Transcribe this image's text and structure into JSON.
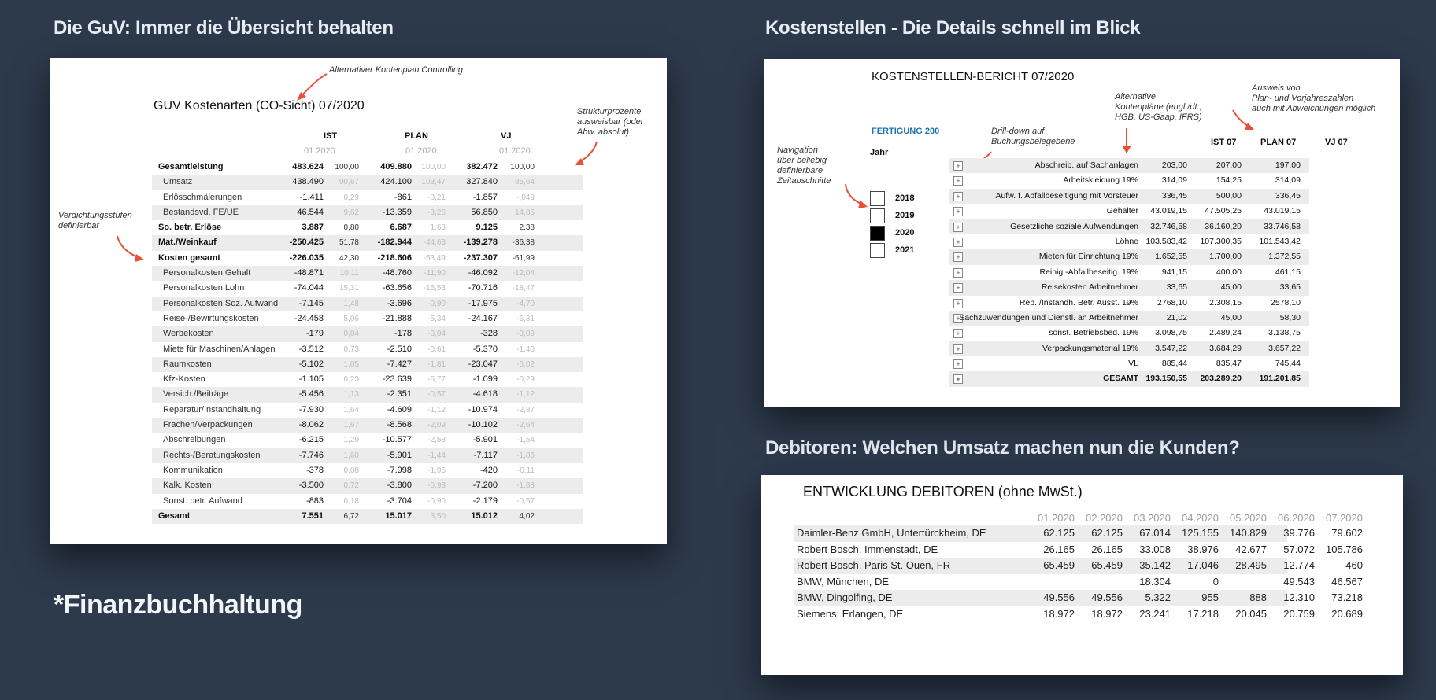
{
  "sections": {
    "guv": "Die GuV: Immer die Übersicht behalten",
    "kost": "Kostenstellen - Die Details schnell im Blick",
    "debit": "Debitoren: Welchen Umsatz machen nun die Kunden?"
  },
  "footer": "*Finanzbuchhaltung",
  "guv": {
    "title": "GUV Kostenarten (CO-Sicht) 07/2020",
    "notes": {
      "kontenplan": "Alternativer Kontenplan Controlling",
      "struktur": [
        "Strukturprozente",
        "ausweisbar (oder",
        "Abw. absolut)"
      ],
      "verdichtung": [
        "Verdichtungsstufen",
        "definierbar"
      ]
    },
    "columns": [
      "IST",
      "PLAN",
      "VJ"
    ],
    "periods": [
      "01.2020",
      "01.2020",
      "01.2020"
    ],
    "rows": [
      {
        "label": "Gesamtleistung",
        "v": [
          "483.624",
          "100,00",
          "409.880",
          "100,00",
          "382.472",
          "100,00"
        ],
        "bold": true,
        "alt": false
      },
      {
        "label": "Umsatz",
        "v": [
          "438.490",
          "90,67",
          "424.100",
          "103,47",
          "327.840",
          "85,64"
        ],
        "bold": false,
        "alt": true
      },
      {
        "label": "Erlösschmälerungen",
        "v": [
          "-1.411",
          "0,29",
          "-861",
          "-0,21",
          "-1.857",
          "-,049"
        ],
        "bold": false,
        "alt": false
      },
      {
        "label": "Bestandsvd. FE/UE",
        "v": [
          "46.544",
          "9,62",
          "-13.359",
          "-3,26",
          "56.850",
          "14,85"
        ],
        "bold": false,
        "alt": true
      },
      {
        "label": "So. betr. Erlöse",
        "v": [
          "3.887",
          "0,80",
          "6.687",
          "1,63",
          "9.125",
          "2,38"
        ],
        "bold": true,
        "alt": false
      },
      {
        "label": "Mat./Weinkauf",
        "v": [
          "-250.425",
          "51,78",
          "-182.944",
          "-44,63",
          "-139.278",
          "-36,38"
        ],
        "bold": true,
        "alt": true
      },
      {
        "label": "Kosten gesamt",
        "v": [
          "-226.035",
          "42,30",
          "-218.606",
          "-53,49",
          "-237.307",
          "-61,99"
        ],
        "bold": true,
        "alt": false
      },
      {
        "label": "Personalkosten Gehalt",
        "v": [
          "-48.871",
          "10,11",
          "-48.760",
          "-11,90",
          "-46.092",
          "-12,04"
        ],
        "bold": false,
        "alt": true
      },
      {
        "label": "Personalkosten Lohn",
        "v": [
          "-74.044",
          "15,31",
          "-63.656",
          "-15,53",
          "-70.716",
          "-18,47"
        ],
        "bold": false,
        "alt": false
      },
      {
        "label": "Personalkosten Soz. Aufwand",
        "v": [
          "-7.145",
          "1,48",
          "-3.696",
          "-0,90",
          "-17.975",
          "-4,70"
        ],
        "bold": false,
        "alt": true
      },
      {
        "label": "Reise-/Bewirtungskosten",
        "v": [
          "-24.458",
          "5,06",
          "-21.888",
          "-5,34",
          "-24.167",
          "-6,31"
        ],
        "bold": false,
        "alt": false
      },
      {
        "label": "Werbekosten",
        "v": [
          "-179",
          "0,04",
          "-178",
          "-0,04",
          "-328",
          "-0,09"
        ],
        "bold": false,
        "alt": true
      },
      {
        "label": "Miete für Maschinen/Anlagen",
        "v": [
          "-3.512",
          "0,73",
          "-2.510",
          "-0,61",
          "-5.370",
          "-1,40"
        ],
        "bold": false,
        "alt": false
      },
      {
        "label": "Raumkosten",
        "v": [
          "-5.102",
          "1,05",
          "-7.427",
          "-1,81",
          "-23.047",
          "-6,02"
        ],
        "bold": false,
        "alt": true
      },
      {
        "label": "Kfz-Kosten",
        "v": [
          "-1.105",
          "0,23",
          "-23.639",
          "-5,77",
          "-1.099",
          "-0,29"
        ],
        "bold": false,
        "alt": false
      },
      {
        "label": "Versich./Beiträge",
        "v": [
          "-5.456",
          "1,13",
          "-2.351",
          "-0,57",
          "-4.618",
          "-1,12"
        ],
        "bold": false,
        "alt": true
      },
      {
        "label": "Reparatur/Instandhaltung",
        "v": [
          "-7.930",
          "1,64",
          "-4.609",
          "-1,12",
          "-10.974",
          "-2,87"
        ],
        "bold": false,
        "alt": false
      },
      {
        "label": "Frachen/Verpackungen",
        "v": [
          "-8.062",
          "1,67",
          "-8.568",
          "-2,09",
          "-10.102",
          "-2,64"
        ],
        "bold": false,
        "alt": true
      },
      {
        "label": "Abschreibungen",
        "v": [
          "-6.215",
          "1,29",
          "-10.577",
          "-2,58",
          "-5.901",
          "-1,54"
        ],
        "bold": false,
        "alt": false
      },
      {
        "label": "Rechts-/Beratungskosten",
        "v": [
          "-7.746",
          "1,60",
          "-5.901",
          "-1,44",
          "-7.117",
          "-1,86"
        ],
        "bold": false,
        "alt": true
      },
      {
        "label": "Kommunikation",
        "v": [
          "-378",
          "0,08",
          "-7.998",
          "-1,95",
          "-420",
          "-0,11"
        ],
        "bold": false,
        "alt": false
      },
      {
        "label": "Kalk. Kosten",
        "v": [
          "-3.500",
          "0,72",
          "-3.800",
          "-0,93",
          "-7.200",
          "-1,88"
        ],
        "bold": false,
        "alt": true
      },
      {
        "label": "Sonst. betr. Aufwand",
        "v": [
          "-883",
          "0,18",
          "-3.704",
          "-0,90",
          "-2.179",
          "-0,57"
        ],
        "bold": false,
        "alt": false
      },
      {
        "label": "Gesamt",
        "v": [
          "7.551",
          "6,72",
          "15.017",
          "3,50",
          "15.012",
          "4,02"
        ],
        "bold": true,
        "alt": true
      }
    ]
  },
  "kost": {
    "title": "KOSTENSTELLEN-BERICHT 07/2020",
    "fertigung": "FERTIGUNG 200",
    "jahr_label": "Jahr",
    "years": [
      {
        "label": "2018",
        "checked": false
      },
      {
        "label": "2019",
        "checked": false
      },
      {
        "label": "2020",
        "checked": true
      },
      {
        "label": "2021",
        "checked": false
      }
    ],
    "notes": {
      "navigation": [
        "Navigation",
        "über beliebig",
        "definierbare",
        "Zeitabschnitte"
      ],
      "drilldown": [
        "Drill-down auf",
        "Buchungsbelegebene"
      ],
      "alternative": [
        "Alternative",
        "Kontenpläne (engl./dt.,",
        "HGB, US-Gaap, IFRS)"
      ],
      "ausweis": [
        "Ausweis von",
        "Plan- und Vorjahreszahlen",
        "auch mit Abweichungen möglich"
      ]
    },
    "columns": [
      "IST 07",
      "PLAN 07",
      "VJ 07"
    ],
    "rows": [
      {
        "label": "Abschreib. auf Sachanlagen",
        "v": [
          "203,00",
          "207,00",
          "197,00"
        ],
        "alt": true,
        "total": false
      },
      {
        "label": "Arbeitskleidung 19%",
        "v": [
          "314,09",
          "154,25",
          "314,09"
        ],
        "alt": false,
        "total": false
      },
      {
        "label": "Aufw. f. Abfallbeseitigung mit Vorsteuer",
        "v": [
          "336,45",
          "500,00",
          "336,45"
        ],
        "alt": true,
        "total": false
      },
      {
        "label": "Gehälter",
        "v": [
          "43.019,15",
          "47.505,25",
          "43.019,15"
        ],
        "alt": false,
        "total": false
      },
      {
        "label": "Gesetzliche soziale Aufwendungen",
        "v": [
          "32.746,58",
          "36.160,20",
          "33.746,58"
        ],
        "alt": true,
        "total": false
      },
      {
        "label": "Löhne",
        "v": [
          "103.583,42",
          "107.300,35",
          "101.543,42"
        ],
        "alt": false,
        "total": false
      },
      {
        "label": "Mieten für Einrichtung 19%",
        "v": [
          "1.652,55",
          "1.700,00",
          "1.372,55"
        ],
        "alt": true,
        "total": false
      },
      {
        "label": "Reinig.-Abfallbeseitig. 19%",
        "v": [
          "941,15",
          "400,00",
          "461,15"
        ],
        "alt": false,
        "total": false
      },
      {
        "label": "Reisekosten Arbeitnehmer",
        "v": [
          "33,65",
          "45,00",
          "33,65"
        ],
        "alt": true,
        "total": false
      },
      {
        "label": "Rep. /Instandh. Betr. Ausst. 19%",
        "v": [
          "2768,10",
          "2.308,15",
          "2578,10"
        ],
        "alt": false,
        "total": false
      },
      {
        "label": "Sachzuwendungen und Dienstl. an Arbeitnehmer",
        "v": [
          "21,02",
          "45,00",
          "58,30"
        ],
        "alt": true,
        "total": false
      },
      {
        "label": "sonst. Betriebsbed. 19%",
        "v": [
          "3.098,75",
          "2.489,24",
          "3.138,75"
        ],
        "alt": false,
        "total": false
      },
      {
        "label": "Verpackungsmaterial 19%",
        "v": [
          "3.547,22",
          "3.684,29",
          "3.657,22"
        ],
        "alt": true,
        "total": false
      },
      {
        "label": "VL",
        "v": [
          "885,44",
          "835,47",
          "745,44"
        ],
        "alt": false,
        "total": false
      },
      {
        "label": "GESAMT",
        "v": [
          "193.150,55",
          "203.289,20",
          "191.201,85"
        ],
        "alt": true,
        "total": true
      }
    ]
  },
  "debit": {
    "title": "ENTWICKLUNG DEBITOREN (ohne MwSt.)",
    "columns": [
      "01.2020",
      "02.2020",
      "03.2020",
      "04.2020",
      "05.2020",
      "06.2020",
      "07.2020"
    ],
    "rows": [
      {
        "label": "Daimler-Benz GmbH, Untertürckheim, DE",
        "v": [
          "62.125",
          "62.125",
          "67.014",
          "125.155",
          "140.829",
          "39.776",
          "79.602"
        ],
        "alt": true
      },
      {
        "label": "Robert Bosch, Immenstadt, DE",
        "v": [
          "26.165",
          "26.165",
          "33.008",
          "38.976",
          "42.677",
          "57.072",
          "105.786"
        ],
        "alt": false
      },
      {
        "label": "Robert Bosch, Paris St. Ouen, FR",
        "v": [
          "65.459",
          "65.459",
          "35.142",
          "17.046",
          "28.495",
          "12.774",
          "460"
        ],
        "alt": true
      },
      {
        "label": "BMW, München, DE",
        "v": [
          "",
          "",
          "18.304",
          "0",
          "",
          "49.543",
          "46.567"
        ],
        "alt": false
      },
      {
        "label": "BMW, Dingolfing, DE",
        "v": [
          "49.556",
          "49.556",
          "5.322",
          "955",
          "888",
          "12.310",
          "73.218"
        ],
        "alt": true
      },
      {
        "label": "Siemens, Erlangen, DE",
        "v": [
          "18.972",
          "18.972",
          "23.241",
          "17.218",
          "20.045",
          "20.759",
          "20.689"
        ],
        "alt": false
      }
    ]
  },
  "colors": {
    "background": "#2d3a4c",
    "arrow": "#e8503a",
    "accent_blue": "#1e73b0",
    "row_alt": "#ececec"
  }
}
